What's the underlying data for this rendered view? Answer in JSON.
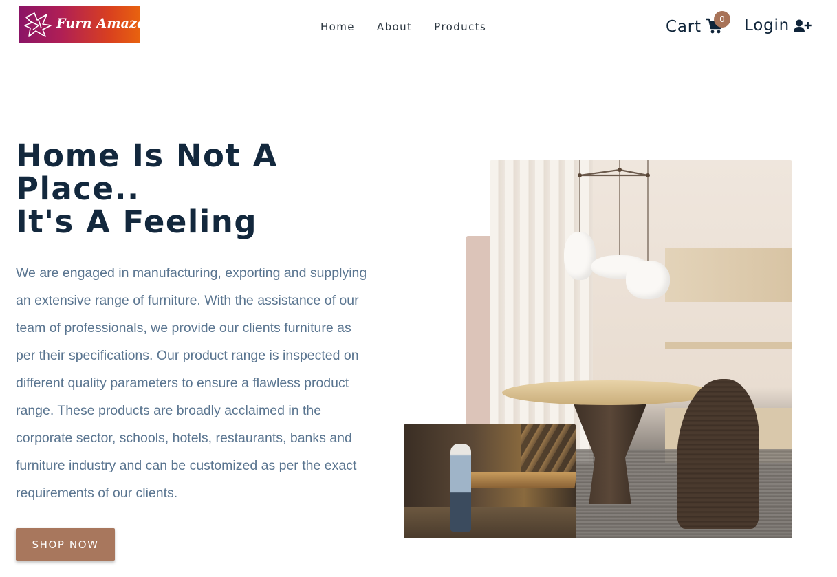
{
  "brand": {
    "name": "Furn Amaze"
  },
  "nav": {
    "items": [
      {
        "label": "Home"
      },
      {
        "label": "About"
      },
      {
        "label": "Products"
      }
    ]
  },
  "cart": {
    "label": "Cart",
    "count": "0",
    "icon": "cart-icon"
  },
  "login": {
    "label": "Login",
    "icon": "user-plus-icon"
  },
  "hero": {
    "title_line1": "Home Is Not A",
    "title_line2": "Place..",
    "title_line3": "It's A Feeling",
    "description": "We are engaged in manufacturing, exporting and supplying an extensive range of furniture. With the assistance of our team of professionals, we provide our clients furniture as per their specifications. Our product range is inspected on different quality parameters to ensure a flawless product range. These products are broadly acclaimed in the corporate sector, schools, hotels, restaurants, banks and furniture industry and can be customized as per the exact requirements of our clients.",
    "cta_label": "SHOP NOW"
  },
  "colors": {
    "accent": "#a8775d",
    "heading": "#13283d",
    "body_text": "#5a7590",
    "logo_gradient_start": "#8b1466",
    "logo_gradient_end": "#e8620f",
    "decor_block": "#dcc4b9"
  }
}
